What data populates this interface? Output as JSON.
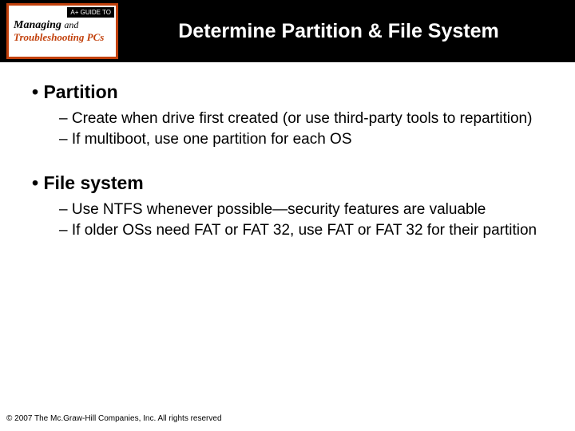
{
  "logo": {
    "corner": "A+ GUIDE TO",
    "line1a": "Managing",
    "line1b": "and",
    "line2": "Troubleshooting PCs"
  },
  "title": "Determine Partition & File System",
  "sections": [
    {
      "heading": "Partition",
      "items": [
        "Create when drive first created (or use third-party tools to repartition)",
        "If multiboot, use one partition for each OS"
      ]
    },
    {
      "heading": "File system",
      "items": [
        "Use NTFS whenever possible—security features are valuable",
        "If older OSs need FAT or FAT 32, use FAT or FAT 32 for their partition"
      ]
    }
  ],
  "footer": "© 2007 The Mc.Graw-Hill Companies, Inc. All rights reserved"
}
